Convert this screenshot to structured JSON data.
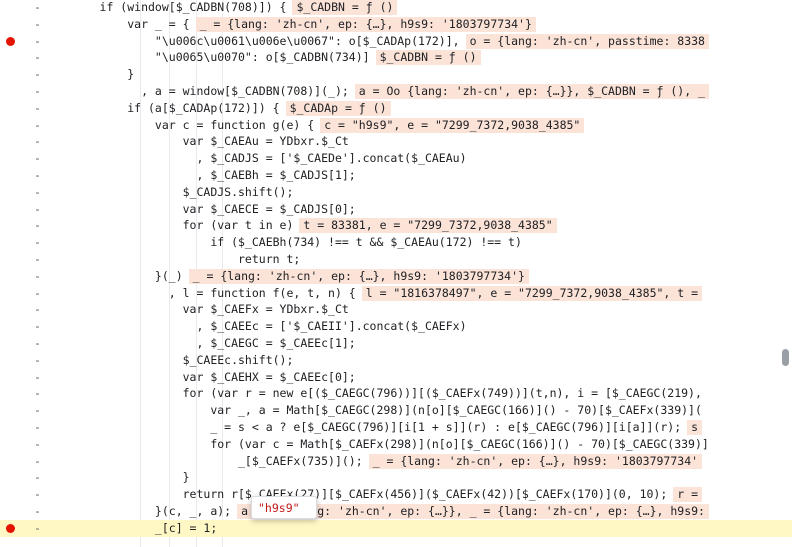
{
  "editor": {
    "lines": [
      {
        "t": "      if (window[$_CADBN(708)]) {",
        "ev": "$_CADBN = ƒ ()",
        "bp": false
      },
      {
        "t": "          var _ = {",
        "ev": "_ = {lang: 'zh-cn', ep: {…}, h9s9: '1803797734'}",
        "bp": false
      },
      {
        "t": "              \"\\u006c\\u0061\\u006e\\u0067\": o[$_CADAp(172)],",
        "ev": "o = {lang: 'zh-cn', passtime: 8338",
        "bp": true
      },
      {
        "t": "              \"\\u0065\\u0070\": o[$_CADBN(734)]",
        "ev": "$_CADBN = ƒ ()",
        "bp": false
      },
      {
        "t": "          }",
        "ev": "",
        "bp": false
      },
      {
        "t": "            , a = window[$_CADBN(708)](_);",
        "ev": "a = Oo {lang: 'zh-cn', ep: {…}}, $_CADBN = ƒ (), _",
        "bp": false
      },
      {
        "t": "          if (a[$_CADAp(172)]) {",
        "ev": "$_CADAp = ƒ ()",
        "bp": false
      },
      {
        "t": "              var c = function g(e) {",
        "ev": "c = \"h9s9\", e = \"7299_7372,9038_4385\"",
        "bp": false
      },
      {
        "t": "                  var $_CAEAu = YDbxr.$_Ct",
        "ev": "",
        "bp": false
      },
      {
        "t": "                    , $_CADJS = ['$_CAEDe'].concat($_CAEAu)",
        "ev": "",
        "bp": false
      },
      {
        "t": "                    , $_CAEBh = $_CADJS[1];",
        "ev": "",
        "bp": false
      },
      {
        "t": "                  $_CADJS.shift();",
        "ev": "",
        "bp": false
      },
      {
        "t": "                  var $_CAECE = $_CADJS[0];",
        "ev": "",
        "bp": false
      },
      {
        "t": "                  for (var t in e)",
        "ev": "t = 83381, e = \"7299_7372,9038_4385\"",
        "bp": false
      },
      {
        "t": "                      if ($_CAEBh(734) !== t && $_CAEAu(172) !== t)",
        "ev": "",
        "bp": false
      },
      {
        "t": "                          return t;",
        "ev": "",
        "bp": false
      },
      {
        "t": "              }(_)",
        "ev": "_ = {lang: 'zh-cn', ep: {…}, h9s9: '1803797734'}",
        "bp": false
      },
      {
        "t": "                , l = function f(e, t, n) {",
        "ev": "l = \"1816378497\", e = \"7299_7372,9038_4385\", t =",
        "bp": false
      },
      {
        "t": "                  var $_CAEFx = YDbxr.$_Ct",
        "ev": "",
        "bp": false
      },
      {
        "t": "                    , $_CAEEc = ['$_CAEII'].concat($_CAEFx)",
        "ev": "",
        "bp": false
      },
      {
        "t": "                    , $_CAEGC = $_CAEEc[1];",
        "ev": "",
        "bp": false
      },
      {
        "t": "                  $_CAEEc.shift();",
        "ev": "",
        "bp": false
      },
      {
        "t": "                  var $_CAEHX = $_CAEEc[0];",
        "ev": "",
        "bp": false
      },
      {
        "t": "                  for (var r = new e[($_CAEGC(796))][($_CAEFx(749))](t,n), i = [$_CAEGC(219),",
        "ev": "",
        "bp": false
      },
      {
        "t": "                      var _, a = Math[$_CAEGC(298)](n[o][$_CAEGC(166)]() - 70)[$_CAEFx(339)](",
        "ev": "",
        "bp": false
      },
      {
        "t": "                      _ = s < a ? e[$_CAEGC(796)][i[1 + s]](r) : e[$_CAEGC(796)][i[a]](r);",
        "ev": "s",
        "bp": false
      },
      {
        "t": "                      for (var c = Math[$_CAEFx(298)](n[o][$_CAEGC(166)]() - 70)[$_CAEGC(339)]",
        "ev": "",
        "bp": false
      },
      {
        "t": "                          _[$_CAEFx(735)]();",
        "ev": "_ = {lang: 'zh-cn', ep: {…}, h9s9: '1803797734'",
        "bp": false
      },
      {
        "t": "                  }",
        "ev": "",
        "bp": false
      },
      {
        "t": "                  return r[$_CAEFx(27)][$_CAEFx(456)]($_CAEFx(42))[$_CAEFx(170)](0, 10);",
        "ev": "r =",
        "bp": false
      },
      {
        "t": "              }(c, _, a);",
        "ev": "a = Oo {lang: 'zh-cn', ep: {…}}, _ = {lang: 'zh-cn', ep: {…}, h9s9:",
        "bp": false
      },
      {
        "t": "              _[c] = 1;",
        "ev": "",
        "bp": true,
        "exec": true
      }
    ]
  },
  "tooltip": {
    "value": "\"h9s9\""
  }
}
